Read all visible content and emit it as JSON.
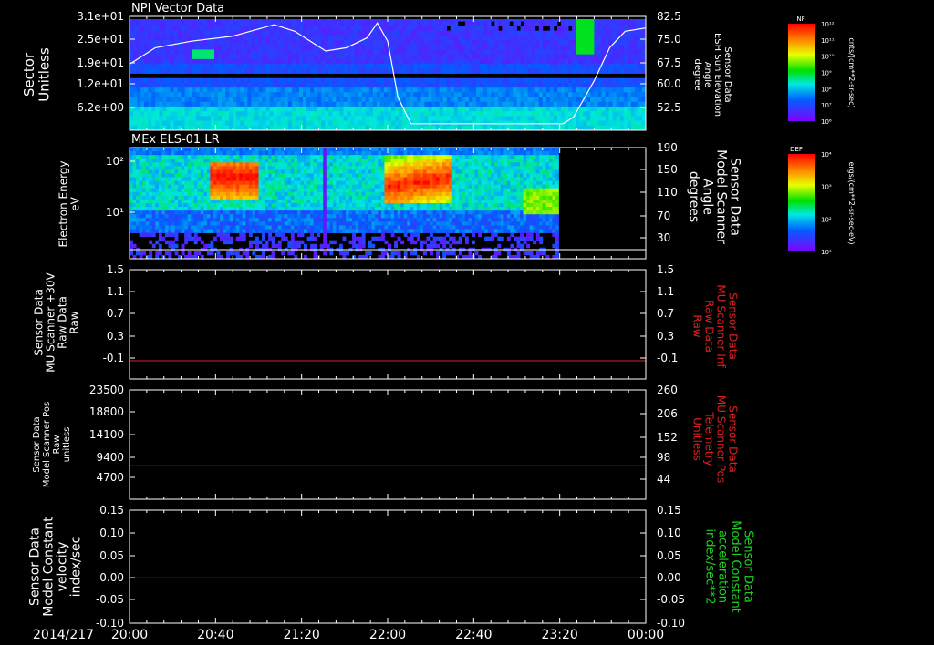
{
  "figure": {
    "date_label": "2014/217",
    "time_ticks": [
      "20:00",
      "20:40",
      "21:20",
      "22:00",
      "22:40",
      "23:20",
      "00:00"
    ]
  },
  "chart_data": [
    {
      "type": "heatmap",
      "title": "NPI Vector Data",
      "ylabel": "Sector\nUnitless",
      "yticks": [
        "3.1e+01",
        "2.5e+01",
        "1.9e+01",
        "1.2e+01",
        "6.2e+00"
      ],
      "right_label": "Sensor Data\nESH Sun Elevation\nAngle\ndegree",
      "right_ticks": [
        "82.5",
        "75.0",
        "67.5",
        "60.0",
        "52.5"
      ],
      "right_range": [
        48,
        82.5
      ],
      "colorbar": {
        "title": "NF",
        "units": "cnts/(cm**2-sr-sec)",
        "ticks": [
          "10¹²",
          "10¹¹",
          "10¹⁰",
          "10⁹",
          "10⁸",
          "10⁷",
          "10⁶"
        ]
      },
      "overlay_line": {
        "name": "ESH Sun Elevation Angle",
        "color": "#ffffff",
        "points": [
          [
            0,
            68
          ],
          [
            0.05,
            73
          ],
          [
            0.12,
            75
          ],
          [
            0.2,
            76.5
          ],
          [
            0.28,
            80
          ],
          [
            0.32,
            78
          ],
          [
            0.38,
            72
          ],
          [
            0.42,
            73
          ],
          [
            0.46,
            76
          ],
          [
            0.48,
            80.5
          ],
          [
            0.5,
            75
          ],
          [
            0.52,
            58
          ],
          [
            0.545,
            50
          ],
          [
            0.58,
            50
          ],
          [
            0.7,
            50
          ],
          [
            0.84,
            50
          ],
          [
            0.86,
            52
          ],
          [
            0.9,
            63
          ],
          [
            0.93,
            73
          ],
          [
            0.96,
            78
          ],
          [
            1.0,
            79
          ]
        ]
      }
    },
    {
      "type": "heatmap",
      "title": "MEx ELS-01 LR",
      "ylabel": "Electron Energy\neV",
      "yticks": [
        "10²",
        "10¹"
      ],
      "right_label": "Sensor Data\nModel Scanner\nAngle\ndegrees",
      "right_ticks": [
        "190",
        "150",
        "110",
        "70",
        "30"
      ],
      "colorbar": {
        "title": "DEF",
        "units": "ergs/(cm**2-sr-sec-eV)",
        "ticks": [
          "10⁴",
          "10³",
          "10²",
          "10¹"
        ]
      },
      "overlay_line": {
        "name": "Model Scanner Angle",
        "value": 10,
        "color": "#ffffff"
      }
    },
    {
      "type": "line",
      "ylabel": "Sensor Data\nMU Scanner +30V\nRaw Data\nRaw",
      "yticks": [
        "1.5",
        "1.1",
        "0.7",
        "0.3",
        "-0.1"
      ],
      "ylim": [
        -0.3,
        1.5
      ],
      "right_label": "Sensor Data\nMU Scanner Inf\nRaw Data\nRaw",
      "right_ticks": [
        "1.5",
        "1.1",
        "0.7",
        "0.3",
        "-0.1"
      ],
      "series": [
        {
          "color": "#e02020",
          "value": 0.0
        }
      ]
    },
    {
      "type": "line",
      "ylabel": "Sensor Data\nModel Scanner Pos\nRaw\nunitless",
      "yticks": [
        "23500",
        "18800",
        "14100",
        "9400",
        "4700"
      ],
      "ylim": [
        0,
        23500
      ],
      "right_label": "Sensor Data\nMU Scanner Pos\nTelemetry\nUnitless",
      "right_ticks": [
        "260",
        "206",
        "152",
        "98",
        "44"
      ],
      "series": [
        {
          "color": "#e02020",
          "value": 7200
        }
      ]
    },
    {
      "type": "line",
      "ylabel": "Sensor Data\nModel Constant\nvelocity\nindex/sec",
      "yticks": [
        "0.15",
        "0.10",
        "0.05",
        "0.00",
        "-0.05",
        "-0.10"
      ],
      "ylim": [
        -0.1,
        0.15
      ],
      "right_label": "Sensor Data\nModel Constant\nacceleration\nindex/sec**2",
      "right_ticks": [
        "0.15",
        "0.10",
        "0.05",
        "0.00",
        "-0.05",
        "-0.10"
      ],
      "series": [
        {
          "color": "#20d020",
          "value": 0.0
        }
      ]
    }
  ]
}
